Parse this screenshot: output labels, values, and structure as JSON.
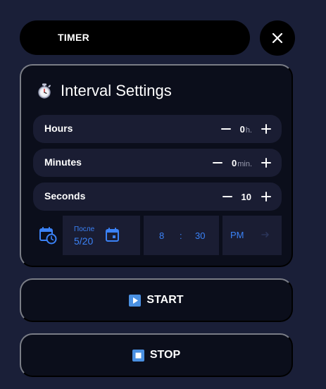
{
  "header": {
    "title": "TIMER",
    "close_icon": "close-icon"
  },
  "panel": {
    "icon": "stopwatch-icon",
    "title": "Interval Settings",
    "rows": [
      {
        "label": "Hours",
        "value": "0",
        "unit": "h."
      },
      {
        "label": "Minutes",
        "value": "0",
        "unit": "min."
      },
      {
        "label": "Seconds",
        "value": "10",
        "unit": ""
      }
    ],
    "schedule": {
      "date_label": "После",
      "date_value": "5/20",
      "hour": "8",
      "separator": ":",
      "minute": "30",
      "ampm": "PM"
    }
  },
  "buttons": {
    "start_label": "START",
    "stop_label": "STOP"
  },
  "colors": {
    "accent": "#3b82f6",
    "background": "#1a1f38",
    "panel": "#0b0e1b",
    "row": "#1a1d33"
  }
}
